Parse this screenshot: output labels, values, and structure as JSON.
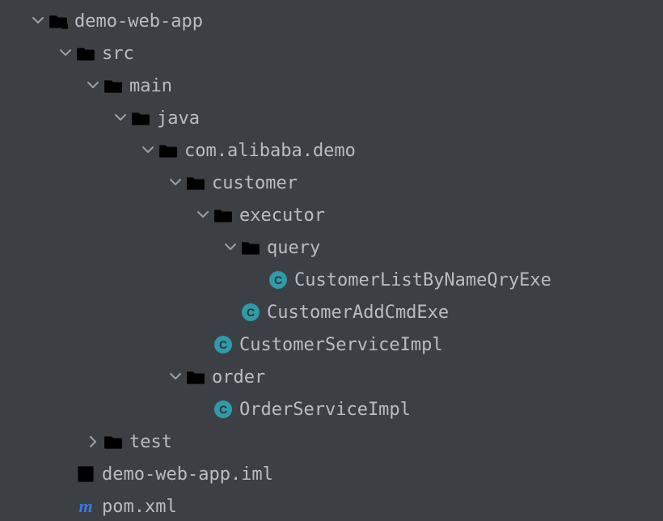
{
  "tree": {
    "root": {
      "label": "demo-web-app",
      "src": {
        "label": "src",
        "main": {
          "label": "main",
          "java": {
            "label": "java",
            "pkg": {
              "label": "com.alibaba.demo",
              "customer": {
                "label": "customer",
                "executor": {
                  "label": "executor",
                  "query": {
                    "label": "query",
                    "file0": "CustomerListByNameQryExe"
                  },
                  "file0": "CustomerAddCmdExe"
                },
                "file0": "CustomerServiceImpl"
              },
              "order": {
                "label": "order",
                "file0": "OrderServiceImpl"
              }
            }
          }
        },
        "test": {
          "label": "test"
        }
      },
      "iml": "demo-web-app.iml",
      "pom": "pom.xml"
    }
  }
}
